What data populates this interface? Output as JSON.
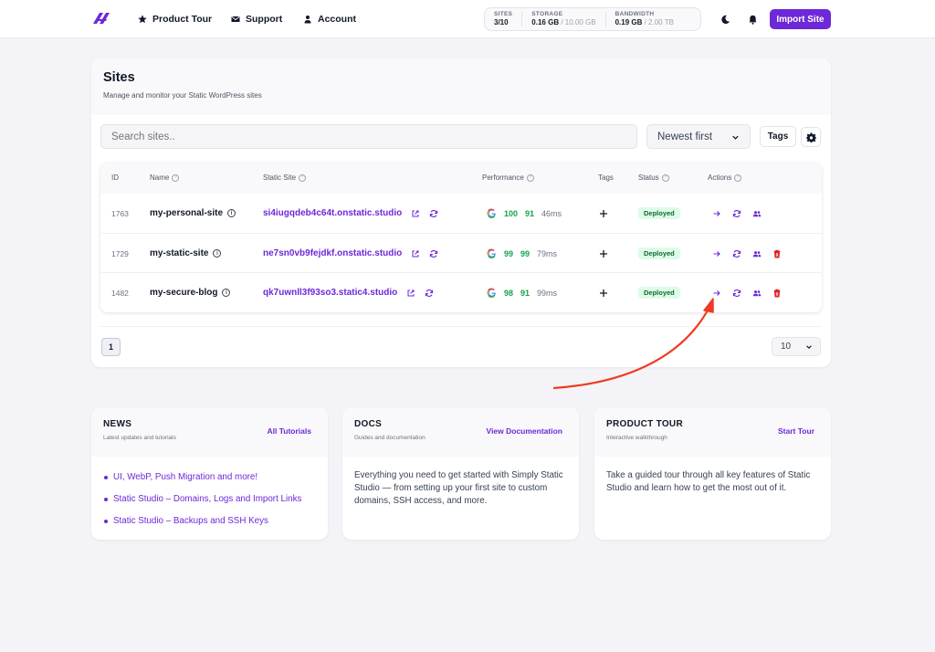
{
  "nav": {
    "product_tour": "Product Tour",
    "support": "Support",
    "account": "Account"
  },
  "stats": {
    "sites_label": "SITES",
    "sites_value": "3/10",
    "storage_label": "STORAGE",
    "storage_used": "0.16 GB",
    "storage_total": "/ 10.00 GB",
    "bandwidth_label": "BANDWIDTH",
    "bandwidth_used": "0.19 GB",
    "bandwidth_total": "/ 2.00 TB"
  },
  "import_button": "Import Site",
  "sites": {
    "title": "Sites",
    "subtitle": "Manage and monitor your Static WordPress sites",
    "search_placeholder": "Search sites..",
    "sort_selected": "Newest first",
    "tags_button": "Tags",
    "columns": {
      "id": "ID",
      "name": "Name",
      "static_site": "Static Site",
      "performance": "Performance",
      "tags": "Tags",
      "status": "Status",
      "actions": "Actions"
    },
    "rows": [
      {
        "id": "1763",
        "name": "my-personal-site",
        "url": "si4iugqdeb4c64t.onstatic.studio",
        "score1": "100",
        "score2": "91",
        "time": "46ms",
        "status": "Deployed"
      },
      {
        "id": "1729",
        "name": "my-static-site",
        "url": "ne7sn0vb9fejdkf.onstatic.studio",
        "score1": "99",
        "score2": "99",
        "time": "79ms",
        "status": "Deployed"
      },
      {
        "id": "1482",
        "name": "my-secure-blog",
        "url": "qk7uwnll3f93so3.static4.studio",
        "score1": "98",
        "score2": "91",
        "time": "99ms",
        "status": "Deployed"
      }
    ],
    "current_page": "1",
    "per_page": "10"
  },
  "news": {
    "title": "NEWS",
    "subtitle": "Latest updates and tutorials",
    "link": "All Tutorials",
    "items": [
      "UI, WebP, Push Migration and more!",
      "Static Studio – Domains, Logs and Import Links",
      "Static Studio – Backups and SSH Keys"
    ]
  },
  "docs": {
    "title": "DOCS",
    "subtitle": "Guides and documentation",
    "link": "View Documentation",
    "body": "Everything you need to get started with Simply Static Studio — from setting up your first site to custom domains, SSH access, and more."
  },
  "tour": {
    "title": "PRODUCT TOUR",
    "subtitle": "Interactive walkthrough",
    "link": "Start Tour",
    "body": "Take a guided tour through all key features of Static Studio and learn how to get the most out of it."
  },
  "colors": {
    "accent": "#6d28d9",
    "success": "#16a34a",
    "danger": "#dc2626",
    "annotation": "#ef3b24"
  }
}
